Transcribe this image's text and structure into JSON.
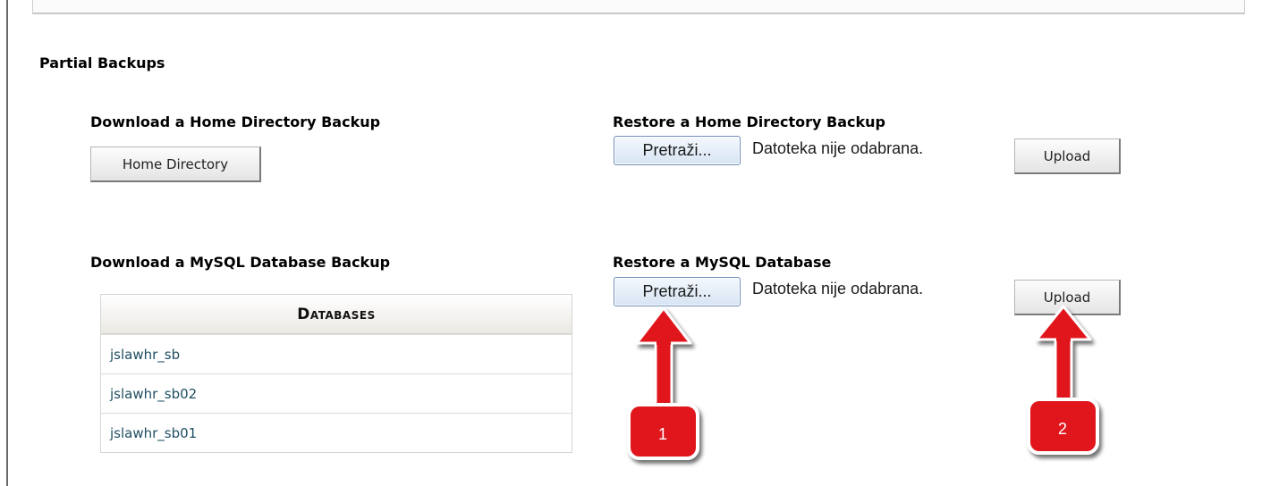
{
  "section": {
    "title": "Partial Backups"
  },
  "home_backup": {
    "download_title": "Download a Home Directory Backup",
    "download_button": "Home Directory",
    "restore_title": "Restore a Home Directory Backup",
    "browse_button": "Pretraži...",
    "file_status": "Datoteka nije odabrana.",
    "upload_button": "Upload"
  },
  "mysql_backup": {
    "download_title": "Download a MySQL Database Backup",
    "restore_title": "Restore a MySQL Database",
    "browse_button": "Pretraži...",
    "file_status": "Datoteka nije odabrana.",
    "upload_button": "Upload",
    "table": {
      "header": "Databases",
      "rows": [
        "jslawhr_sb",
        "jslawhr_sb02",
        "jslawhr_sb01"
      ]
    }
  },
  "annotations": {
    "badges": [
      "1",
      "2"
    ],
    "color": "#e0141e",
    "icons": [
      "arrow-up-icon",
      "arrow-up-icon"
    ]
  }
}
